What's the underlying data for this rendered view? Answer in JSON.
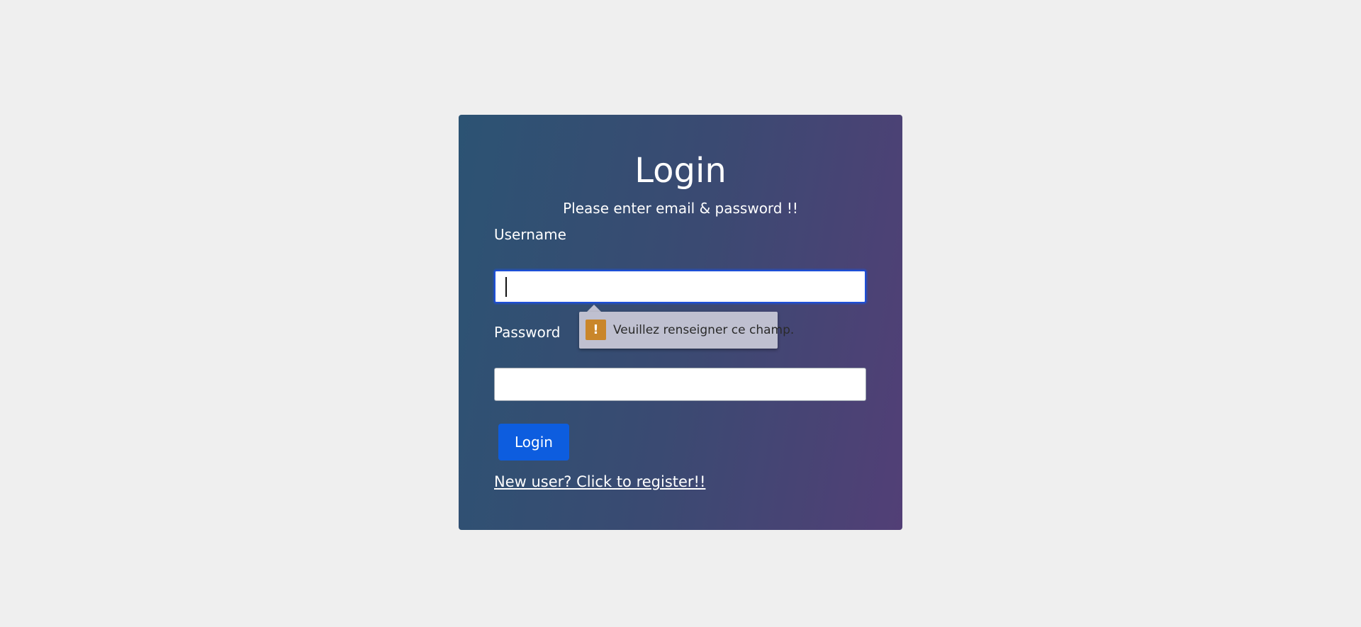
{
  "login_card": {
    "title": "Login",
    "subtitle": "Please enter email & password !!",
    "username_label": "Username",
    "username_value": "",
    "password_label": "Password",
    "password_value": "",
    "submit_label": "Login",
    "register_link": "New user? Click to register!!"
  },
  "validation_tooltip": {
    "icon": "warning-icon",
    "message": "Veuillez renseigner ce champ."
  },
  "colors": {
    "page_background": "#efefef",
    "card_gradient_start": "#2c5373",
    "card_gradient_end": "#523f76",
    "button": "#0d5ddf",
    "focus_border": "#1d4fd8",
    "warning": "#c9862a"
  }
}
